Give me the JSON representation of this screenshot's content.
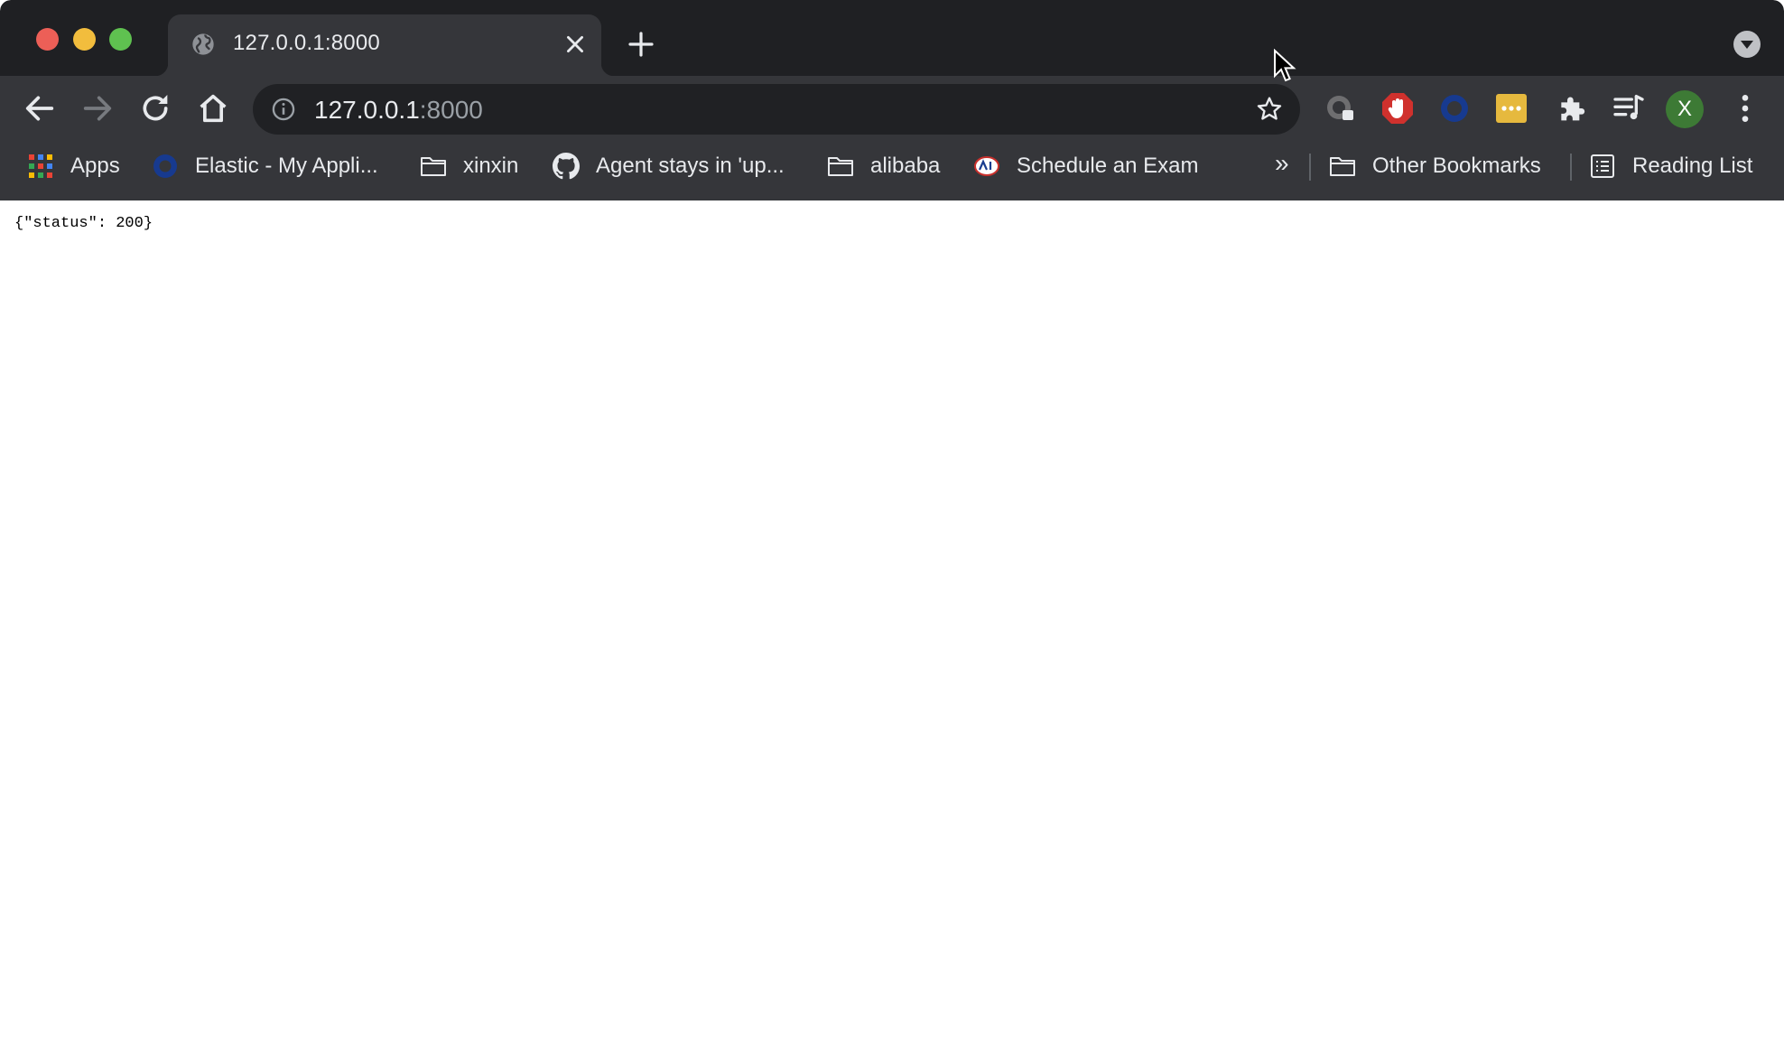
{
  "window": {
    "controls": [
      "close",
      "minimize",
      "maximize"
    ]
  },
  "tab": {
    "title": "127.0.0.1:8000",
    "favicon": "globe-icon"
  },
  "toolbar": {
    "back": "back-arrow-icon",
    "forward": "forward-arrow-icon",
    "reload": "reload-icon",
    "home": "home-icon",
    "extensions": [
      "grammarly-icon",
      "adblock-icon",
      "circle-extension-icon",
      "lastpass-icon",
      "puzzle-icon",
      "reading-list-icon"
    ],
    "profile_initial": "X",
    "menu": "kebab-menu-icon"
  },
  "omnibox": {
    "host": "127.0.0.1",
    "port": ":8000"
  },
  "bookmarks": {
    "items": [
      {
        "label": "Apps",
        "icon": "apps-grid-icon"
      },
      {
        "label": "Elastic - My Appli...",
        "icon": "elastic-icon"
      },
      {
        "label": "xinxin",
        "icon": "folder-icon"
      },
      {
        "label": "Agent stays in 'up...",
        "icon": "github-icon"
      },
      {
        "label": "alibaba",
        "icon": "folder-icon"
      },
      {
        "label": "Schedule an Exam",
        "icon": "pearson-icon"
      }
    ],
    "overflow": "»",
    "other": "Other Bookmarks",
    "reading_list": "Reading List"
  },
  "page": {
    "content": "{\"status\": 200}"
  },
  "colors": {
    "titlebar": "#1f2023",
    "toolbar": "#35363a",
    "omnibox": "#202124",
    "text_light": "#e8eaed",
    "text_dim": "#9aa0a6",
    "avatar": "#3d7a35"
  }
}
